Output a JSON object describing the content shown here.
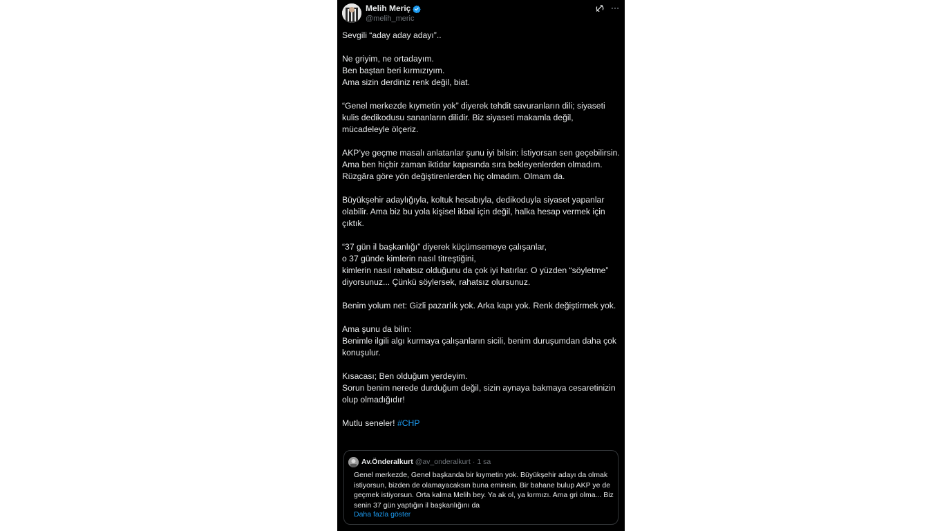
{
  "author": {
    "display_name": "Melih Meriç",
    "handle": "@melih_meric"
  },
  "icons": {
    "verified": "verified-badge-icon",
    "grok": "grok-icon",
    "more": "more-options-icon"
  },
  "colors": {
    "background": "#000000",
    "text": "#e7e9ea",
    "muted": "#71767b",
    "accent": "#1d9bf0",
    "border": "#333639"
  },
  "tweet": {
    "paragraphs": [
      "Sevgili “aday aday adayı”..",
      "Ne griyim, ne ortadayım.\nBen baştan beri kırmızıyım.\nAma sizin derdiniz renk değil, biat.",
      "“Genel merkezde kıymetin yok” diyerek tehdit savuranların dili; siyaseti kulis dedikodusu sananların dilidir. Biz siyaseti makamla değil, mücadeleyle ölçeriz.",
      "AKP’ye geçme masalı anlatanlar şunu iyi bilsin: İstiyorsan sen geçebilirsin.\nAma ben hiçbir zaman iktidar kapısında sıra bekleyenlerden olmadım.\nRüzgâra göre yön değiştirenlerden hiç olmadım. Olmam da.",
      "Büyükşehir adaylığıyla, koltuk hesabıyla, dedikoduyla siyaset yapanlar olabilir. Ama biz bu yola kişisel ikbal için değil, halka hesap vermek için çıktık.",
      "“37 gün il başkanlığı” diyerek küçümsemeye çalışanlar,\no 37 günde kimlerin nasıl titreştiğini,\nkimlerin nasıl rahatsız olduğunu da çok iyi hatırlar. O yüzden “söyletme” diyorsunuz... Çünkü söylersek, rahatsız olursunuz.",
      "Benim yolum net: Gizli pazarlık yok. Arka kapı yok. Renk değiştirmek yok.",
      "Ama şunu da bilin:\nBenimle ilgili algı kurmaya çalışanların sicili, benim duruşumdan daha çok konuşulur.",
      "Kısacası; Ben olduğum yerdeyim.\nSorun benim nerede durduğum değil, sizin aynaya bakmaya cesaretinizin olup olmadığıdır!"
    ],
    "closing_text": "Mutlu seneler! ",
    "hashtag": "#CHP"
  },
  "quote": {
    "display_name": "Av.Önderalkurt",
    "handle": "@av_onderalkurt",
    "dot": "·",
    "time": "1 sa",
    "text": "Genel merkezde, Genel başkanda bir kıymetin yok. Büyükşehir adayı da olmak istiyorsun, bizden de olamayacaksın buna eminsin. Bir bahane bulup AKP ye de geçmek istiyorsun. Orta kalma Melih bey. Ya ak ol, ya kırmızı. Ama gri olma... Biz senin 37 gün yaptığın il başkanlığını da",
    "show_more": "Daha fazla göster"
  }
}
